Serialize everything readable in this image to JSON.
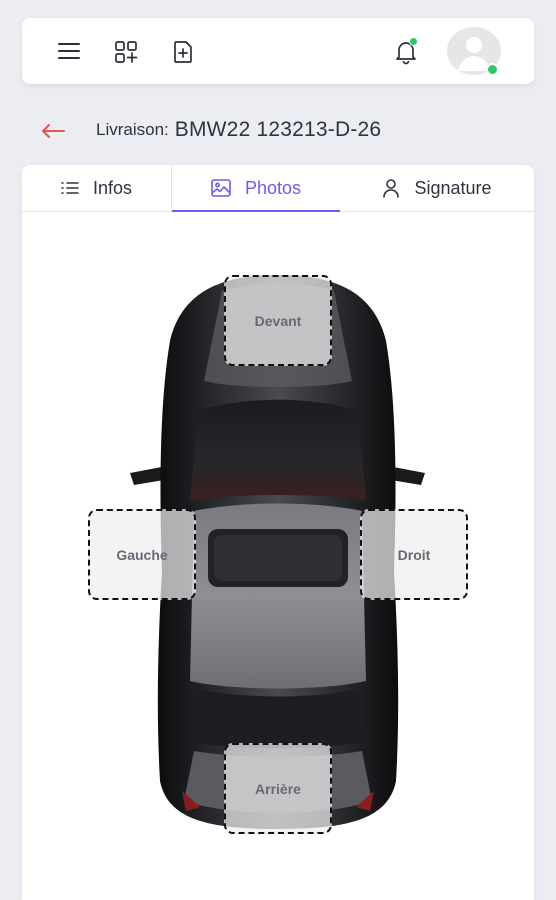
{
  "header": {
    "menu_icon": "menu-icon",
    "apps_icon": "apps-add-icon",
    "new_doc_icon": "file-plus-icon",
    "bell_icon": "bell-icon",
    "avatar_icon": "user-avatar-icon",
    "status_color": "#34c46c"
  },
  "breadcrumb": {
    "back_icon": "arrow-left-icon",
    "label": "Livraison:",
    "value": "BMW22 123213-D-26"
  },
  "tabs": [
    {
      "label": "Infos",
      "icon": "list-icon",
      "active": false
    },
    {
      "label": "Photos",
      "icon": "image-icon",
      "active": true
    },
    {
      "label": "Signature",
      "icon": "user-icon",
      "active": false
    }
  ],
  "accent_color": "#6a5cf0",
  "back_color": "#e4584f",
  "photo_spots": {
    "front": "Devant",
    "left": "Gauche",
    "right": "Droit",
    "rear": "Arrière"
  },
  "car_image": "car-top-view"
}
